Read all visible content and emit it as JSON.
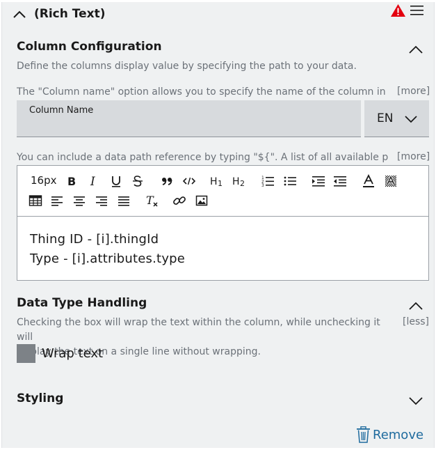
{
  "header": {
    "title": "(Rich Text)"
  },
  "column_config": {
    "title": "Column Configuration",
    "description": "Define the columns display value by specifying the path to your data.",
    "name_hint": "The \"Column name\" option allows you to specify the name of the column in th...",
    "name_hint_more": "[more]",
    "column_name_label": "Column Name",
    "column_name_value": "",
    "language": "EN",
    "path_hint": "You can include a data path reference by typing \"${\". A list of all available path...",
    "path_hint_more": "[more]"
  },
  "editor": {
    "font_size": "16px",
    "lines": [
      "Thing ID - [i].thingId",
      "Type - [i].attributes.type"
    ]
  },
  "data_type": {
    "title": "Data Type Handling",
    "description_1": "Checking the box will wrap the text within the column, while unchecking it will",
    "description_2": "display the text on a single line without wrapping.",
    "less": "[less]",
    "wrap_label": "Wrap text"
  },
  "styling": {
    "title": "Styling"
  },
  "actions": {
    "remove_label": "Remove"
  },
  "colors": {
    "warning": "#e3000f",
    "link": "#1f6b9e",
    "panel": "#eff1f2",
    "input": "#d7dadd"
  }
}
